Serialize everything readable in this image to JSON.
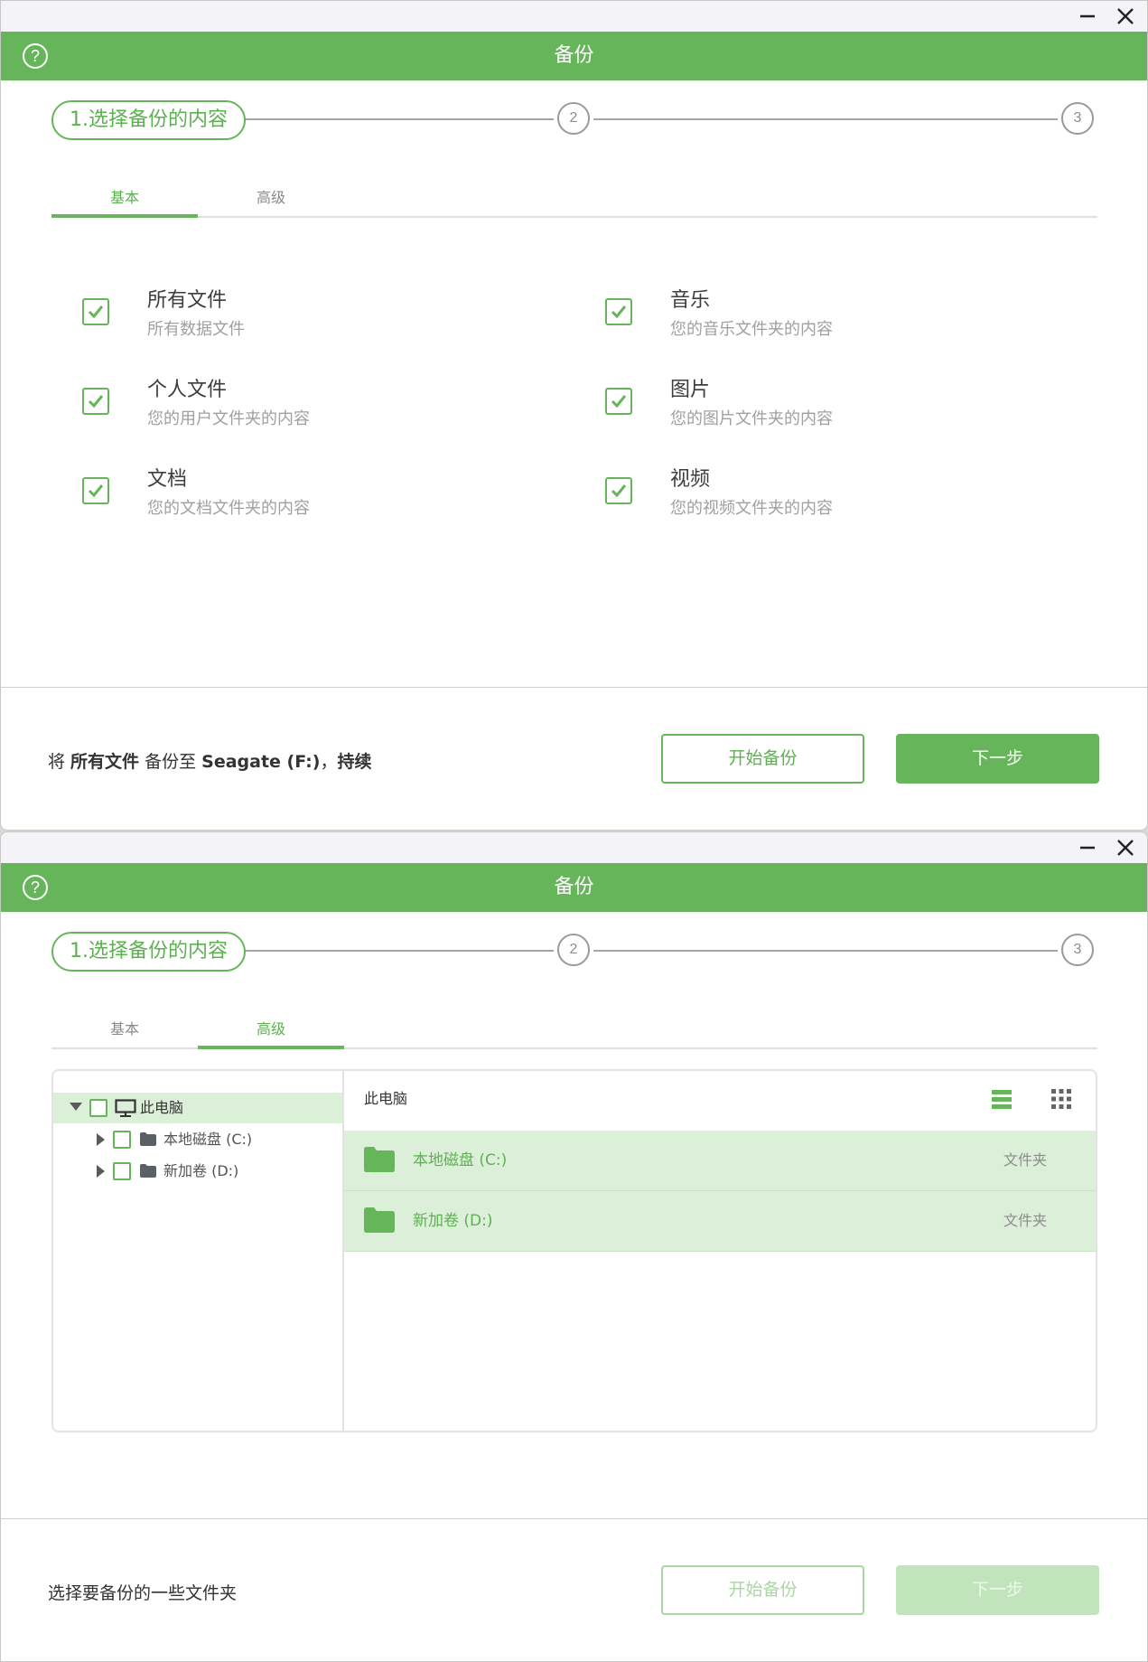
{
  "colors": {
    "accent": "#66b55a",
    "accent_light": "#dcefd9",
    "titlebar_bg": "#f4f3f8"
  },
  "windows": [
    {
      "title": "备份",
      "help_icon": "question-circle-icon",
      "steps": {
        "step1": "1.选择备份的内容",
        "step2": "2",
        "step3": "3"
      },
      "tabs": {
        "basic": "基本",
        "advanced": "高级",
        "active": "basic"
      },
      "options": [
        {
          "title": "所有文件",
          "subtitle": "所有数据文件",
          "checked": true
        },
        {
          "title": "音乐",
          "subtitle": "您的音乐文件夹的内容",
          "checked": true
        },
        {
          "title": "个人文件",
          "subtitle": "您的用户文件夹的内容",
          "checked": true
        },
        {
          "title": "图片",
          "subtitle": "您的图片文件夹的内容",
          "checked": true
        },
        {
          "title": "文档",
          "subtitle": "您的文档文件夹的内容",
          "checked": true
        },
        {
          "title": "视频",
          "subtitle": "您的视频文件夹的内容",
          "checked": true
        }
      ],
      "footer": {
        "prefix": "将 ",
        "what": "所有文件",
        "middle": " 备份至 ",
        "target": "Seagate (F:)",
        "sep": "，",
        "mode": "持续",
        "start_button": "开始备份",
        "next_button": "下一步"
      }
    },
    {
      "title": "备份",
      "help_icon": "question-circle-icon",
      "steps": {
        "step1": "1.选择备份的内容",
        "step2": "2",
        "step3": "3"
      },
      "tabs": {
        "basic": "基本",
        "advanced": "高级",
        "active": "advanced"
      },
      "tree": {
        "root": {
          "label": "此电脑",
          "expanded": true,
          "selected": true,
          "icon": "monitor-icon"
        },
        "children": [
          {
            "label": "本地磁盘 (C:)",
            "icon": "folder-icon"
          },
          {
            "label": "新加卷 (D:)",
            "icon": "folder-icon"
          }
        ]
      },
      "list": {
        "path": "此电脑",
        "view_list_icon": "list-view-icon",
        "view_grid_icon": "grid-view-icon",
        "rows": [
          {
            "name": "本地磁盘 (C:)",
            "type": "文件夹"
          },
          {
            "name": "新加卷 (D:)",
            "type": "文件夹"
          }
        ]
      },
      "footer": {
        "text": "选择要备份的一些文件夹",
        "start_button": "开始备份",
        "next_button": "下一步",
        "buttons_disabled": true
      }
    }
  ]
}
